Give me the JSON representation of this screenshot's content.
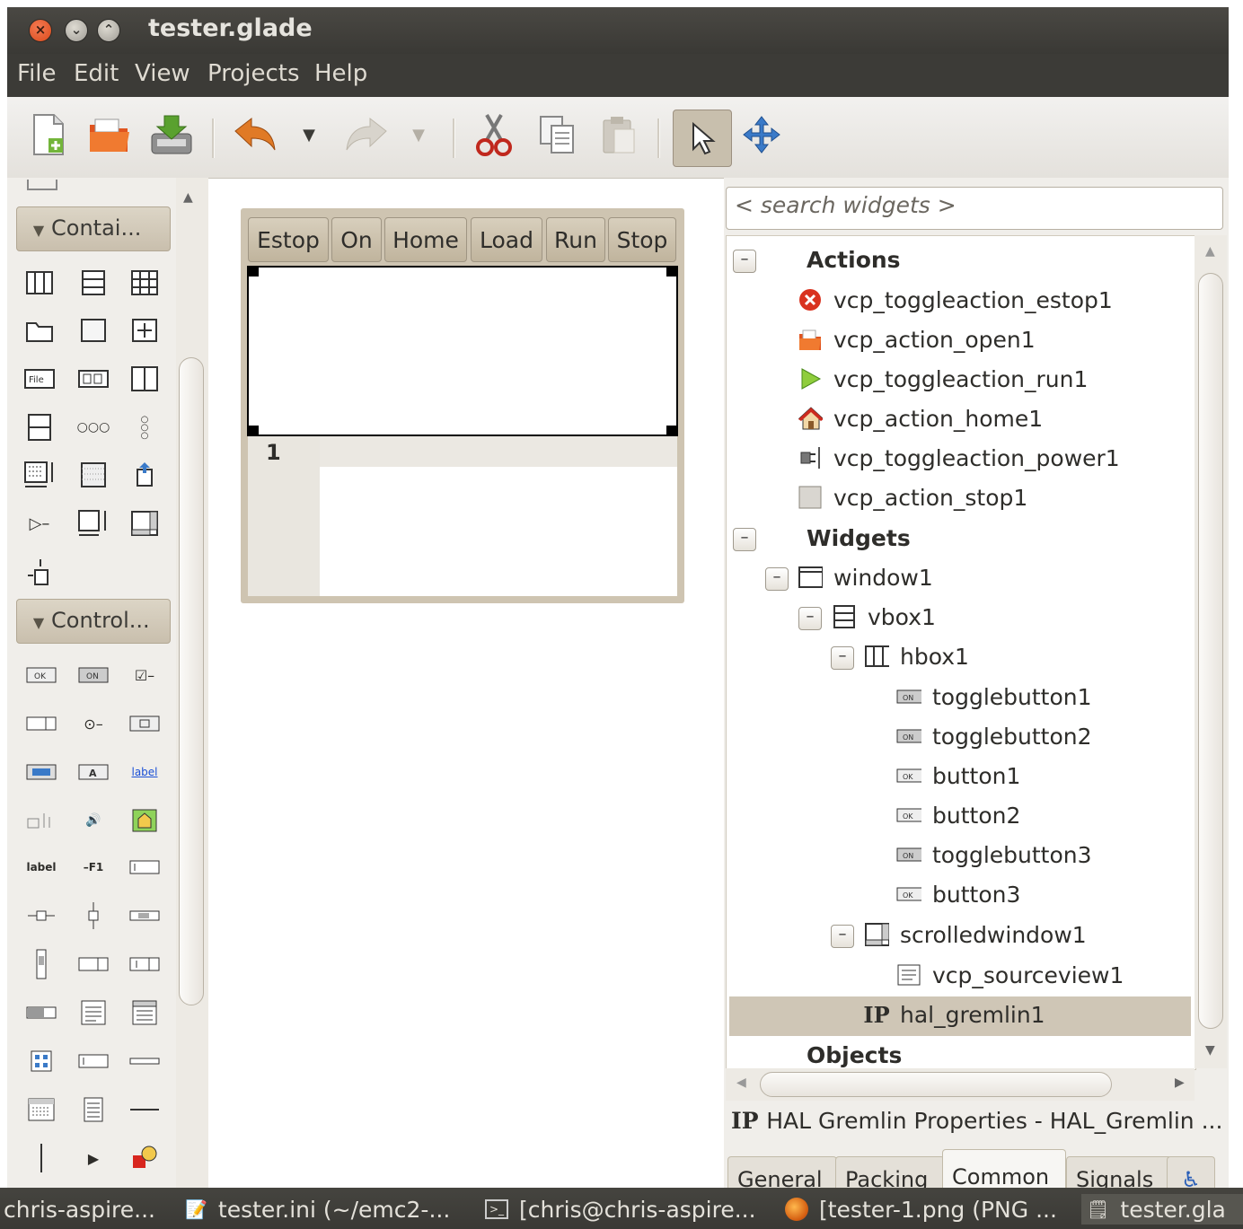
{
  "window": {
    "title": "tester.glade"
  },
  "menu": [
    "File",
    "Edit",
    "View",
    "Projects",
    "Help"
  ],
  "toolbar": {
    "new_icon": "new-file-icon",
    "open_icon": "open-icon",
    "save_icon": "save-icon",
    "undo_icon": "undo-icon",
    "redo_icon": "redo-icon",
    "cut_icon": "cut-icon",
    "copy_icon": "copy-icon",
    "paste_icon": "paste-icon",
    "select_icon": "pointer-icon",
    "drag_icon": "drag-resize-icon"
  },
  "palette": {
    "groups": [
      "Contai...",
      "Control..."
    ]
  },
  "design": {
    "buttons": [
      "Estop",
      "On",
      "Home",
      "Load",
      "Run",
      "Stop"
    ],
    "line_number": "1"
  },
  "inspector": {
    "search_placeholder": "< search widgets >",
    "sections": {
      "actions": "Actions",
      "widgets": "Widgets",
      "objects": "Objects"
    },
    "actions": [
      "vcp_toggleaction_estop1",
      "vcp_action_open1",
      "vcp_toggleaction_run1",
      "vcp_action_home1",
      "vcp_toggleaction_power1",
      "vcp_action_stop1"
    ],
    "widgets": {
      "window": "window1",
      "vbox": "vbox1",
      "hbox": "hbox1",
      "hbox_children": [
        "togglebutton1",
        "togglebutton2",
        "button1",
        "button2",
        "togglebutton3",
        "button3"
      ],
      "scrolled": "scrolledwindow1",
      "sourceview": "vcp_sourceview1",
      "gremlin": "hal_gremlin1"
    },
    "properties_title": "HAL Gremlin Properties - HAL_Gremlin ...",
    "tabs": [
      "General",
      "Packing",
      "Common",
      "Signals"
    ],
    "active_tab": "Common"
  },
  "taskbar": [
    "chris-aspire...",
    "tester.ini (~/emc2-...",
    "[chris@chris-aspire...",
    "[tester-1.png (PNG ...",
    "tester.gla"
  ],
  "colors": {
    "accent": "#cfc6b6",
    "titlebar": "#3c3b37",
    "close": "#e05a2b"
  }
}
